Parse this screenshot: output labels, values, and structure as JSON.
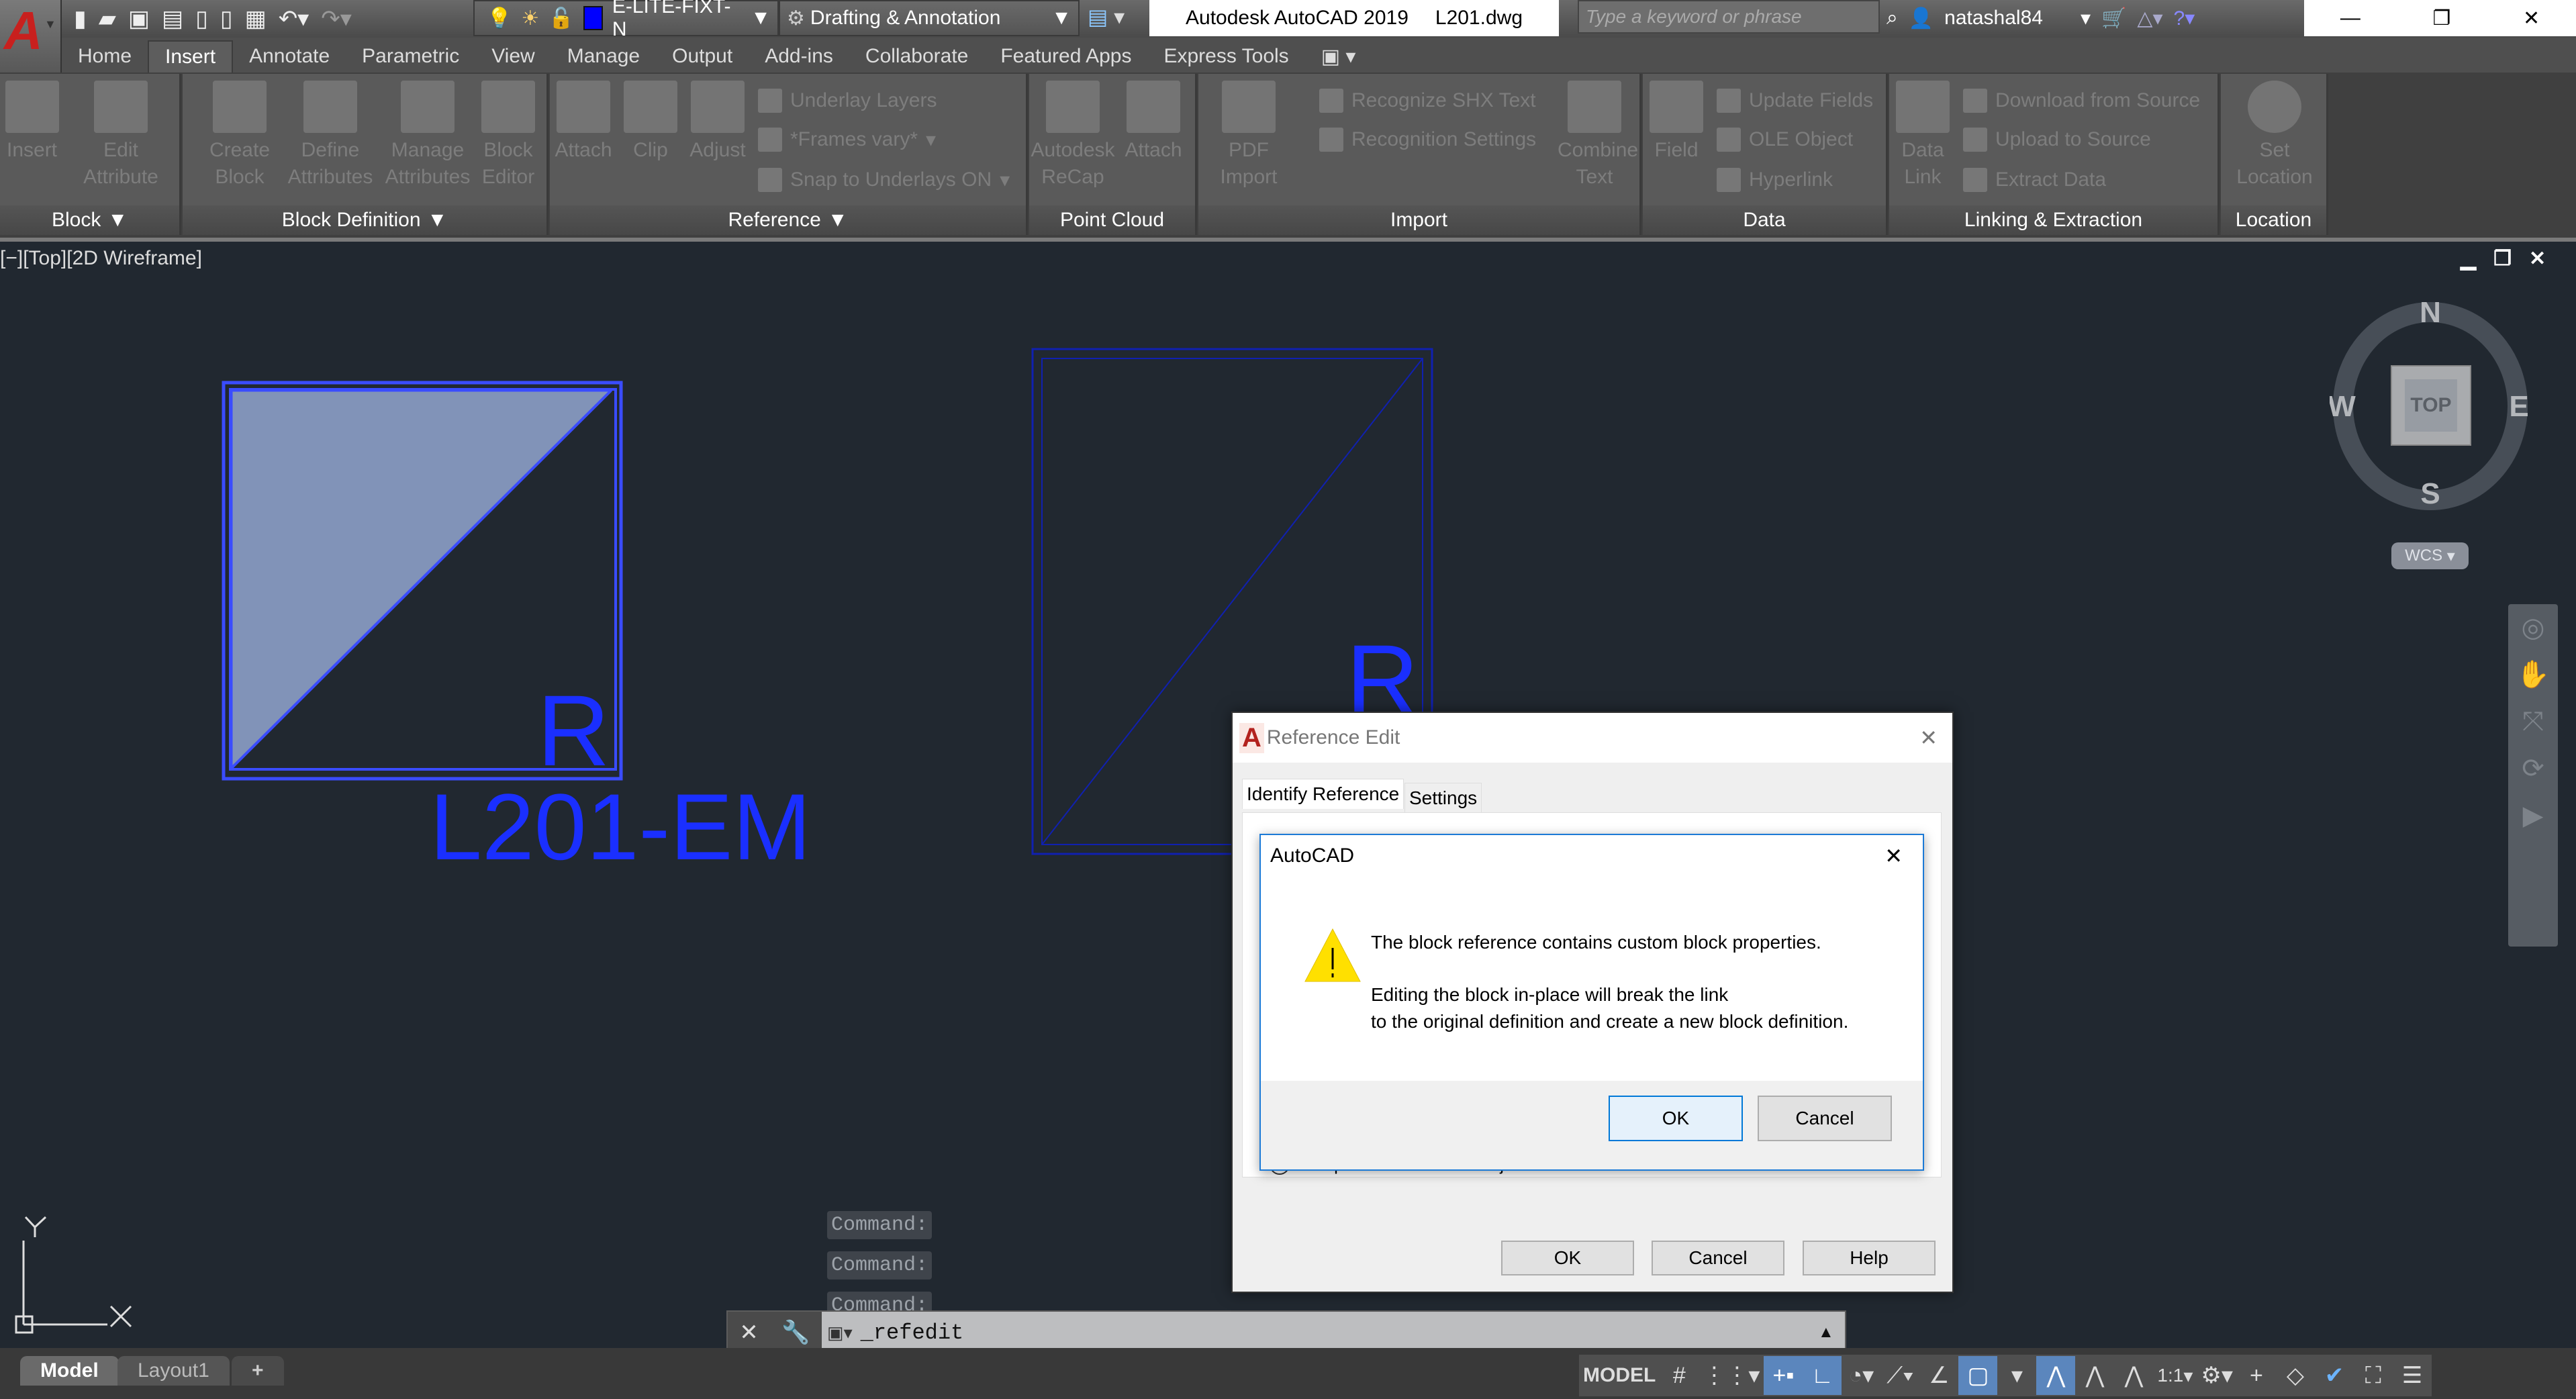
{
  "titlebar": {
    "app_title": "Autodesk AutoCAD 2019",
    "file_name": "L201.dwg",
    "layer_name": "E-LITE-FIXT-N",
    "layer_color": "#0000ff",
    "workspace": "Drafting & Annotation",
    "search_placeholder": "Type a keyword or phrase",
    "username": "natashal84"
  },
  "ribbon_tabs": [
    "Home",
    "Insert",
    "Annotate",
    "Parametric",
    "View",
    "Manage",
    "Output",
    "Add-ins",
    "Collaborate",
    "Featured Apps",
    "Express Tools"
  ],
  "active_tab": "Insert",
  "panels": {
    "block": {
      "title": "Block",
      "tools": [
        "Insert",
        "Edit Attribute"
      ]
    },
    "block_definition": {
      "title": "Block Definition",
      "tools": [
        "Create Block",
        "Define Attributes",
        "Manage Attributes",
        "Block Editor"
      ]
    },
    "reference": {
      "title": "Reference",
      "tools": [
        "Attach",
        "Clip",
        "Adjust"
      ],
      "small": [
        "Underlay Layers",
        "*Frames vary*",
        "Snap to Underlays ON"
      ]
    },
    "point_cloud": {
      "title": "Point Cloud",
      "tools": [
        "Autodesk ReCap",
        "Attach"
      ]
    },
    "import": {
      "title": "Import",
      "tools": [
        "PDF Import",
        "Combine Text"
      ],
      "small": [
        "Recognize SHX Text",
        "Recognition Settings"
      ]
    },
    "data": {
      "title": "Data",
      "tools": [
        "Field"
      ],
      "small": [
        "Update Fields",
        "OLE Object",
        "Hyperlink"
      ]
    },
    "linking": {
      "title": "Linking & Extraction",
      "tools": [
        "Data Link"
      ],
      "small": [
        "Download from Source",
        "Upload to Source",
        "Extract  Data"
      ]
    },
    "location": {
      "title": "Location",
      "tools": [
        "Set Location"
      ]
    }
  },
  "viewport": {
    "label": "[−][Top][2D Wireframe]",
    "viewcube_face": "TOP",
    "compass": {
      "n": "N",
      "s": "S",
      "e": "E",
      "w": "W"
    },
    "ucs": "WCS"
  },
  "drawing": {
    "tag1": "R",
    "label1": "L201-EM",
    "tag2": "R",
    "ucs_x": "X",
    "ucs_y": "Y",
    "color": "#1a2fff"
  },
  "command": {
    "history": [
      "Command:",
      "Command:",
      "Command:"
    ],
    "current": "_refedit"
  },
  "layout_tabs": [
    "Model",
    "Layout1"
  ],
  "status": {
    "model": "MODEL",
    "scale": "1:1"
  },
  "ref_dialog": {
    "title": "Reference Edit",
    "tabs": [
      "Identify Reference",
      "Settings"
    ],
    "radio_label": "Prompt to select nested objects",
    "buttons": [
      "OK",
      "Cancel",
      "Help"
    ]
  },
  "message_box": {
    "title": "AutoCAD",
    "line1": "The block reference contains custom block properties.",
    "line2": "Editing the block in-place will break the link",
    "line3": "to the original definition and create a new block definition.",
    "ok": "OK",
    "cancel": "Cancel"
  }
}
